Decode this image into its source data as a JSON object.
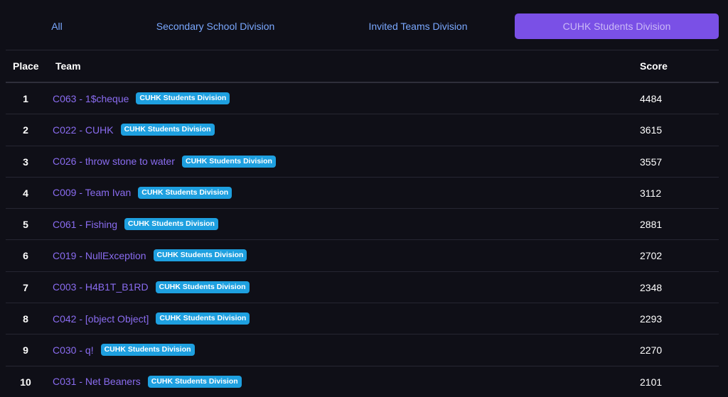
{
  "tabs": [
    {
      "label": "All",
      "active": false
    },
    {
      "label": "Secondary School Division",
      "active": false
    },
    {
      "label": "Invited Teams Division",
      "active": false
    },
    {
      "label": "CUHK Students Division",
      "active": true
    }
  ],
  "table": {
    "headers": {
      "place": "Place",
      "team": "Team",
      "score": "Score"
    },
    "rows": [
      {
        "place": "1",
        "team": "C063 - 1$cheque",
        "badge": "CUHK Students Division",
        "score": "4484"
      },
      {
        "place": "2",
        "team": "C022 - CUHK",
        "badge": "CUHK Students Division",
        "score": "3615"
      },
      {
        "place": "3",
        "team": "C026 - throw stone to water",
        "badge": "CUHK Students Division",
        "score": "3557"
      },
      {
        "place": "4",
        "team": "C009 - Team Ivan",
        "badge": "CUHK Students Division",
        "score": "3112"
      },
      {
        "place": "5",
        "team": "C061 - Fishing",
        "badge": "CUHK Students Division",
        "score": "2881"
      },
      {
        "place": "6",
        "team": "C019 - NullException",
        "badge": "CUHK Students Division",
        "score": "2702"
      },
      {
        "place": "7",
        "team": "C003 - H4B1T_B1RD",
        "badge": "CUHK Students Division",
        "score": "2348"
      },
      {
        "place": "8",
        "team": "C042 - [object Object]",
        "badge": "CUHK Students Division",
        "score": "2293"
      },
      {
        "place": "9",
        "team": "C030 - q!",
        "badge": "CUHK Students Division",
        "score": "2270"
      },
      {
        "place": "10",
        "team": "C031 - Net Beaners",
        "badge": "CUHK Students Division",
        "score": "2101"
      }
    ]
  },
  "colors": {
    "background": "#0f0f17",
    "tab_text": "#7aa8ff",
    "tab_active_bg": "#7a50e6",
    "team_link": "#8a6cf0",
    "badge_bg": "#1ea0e0"
  }
}
